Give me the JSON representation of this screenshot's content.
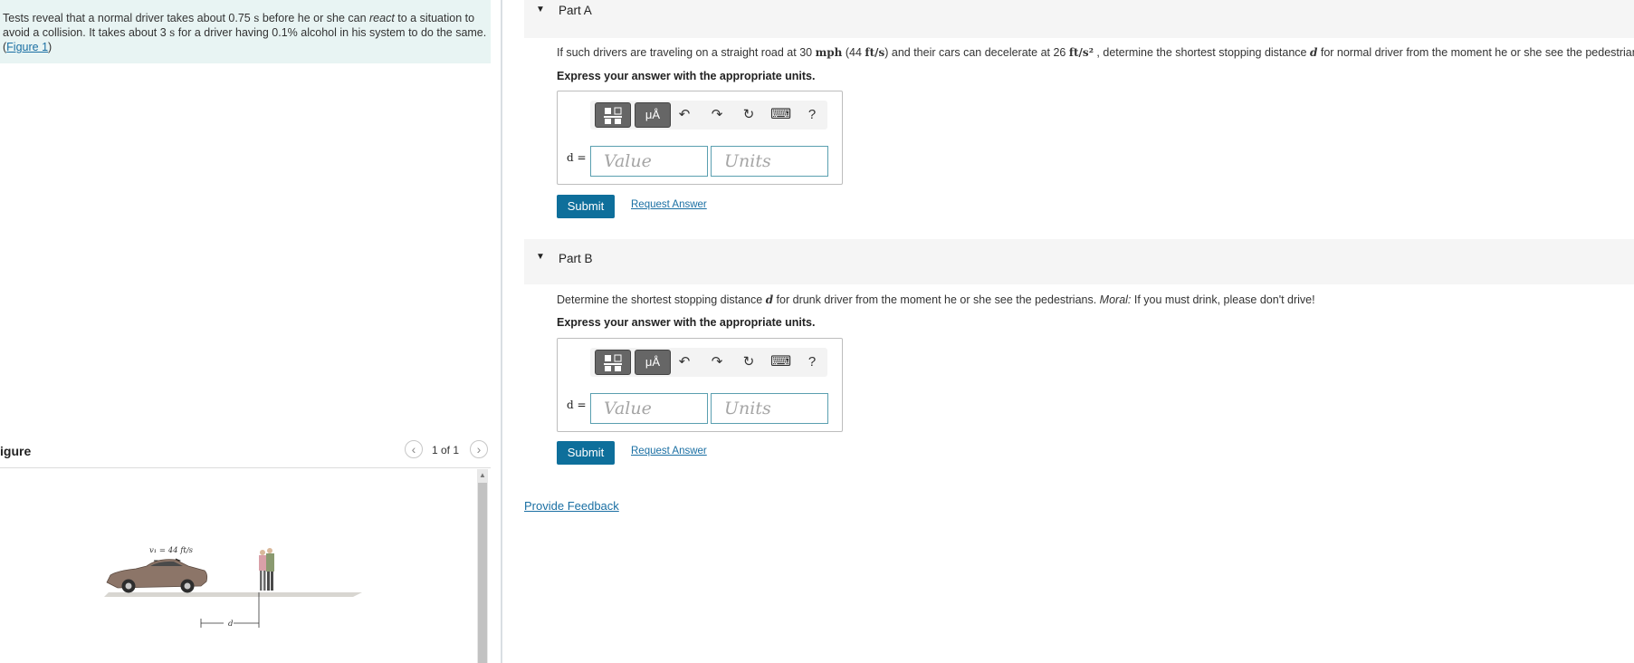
{
  "intro": {
    "line1_a": "Tests reveal that a normal driver takes about 0.75 ",
    "line1_s": "s",
    "line1_b": " before he or she can ",
    "line1_react": "react",
    "line1_c": " to a situation to",
    "line2_a": "avoid a collision. It takes about 3 ",
    "line2_s": "s",
    "line2_b": " for a driver having 0.1% alcohol in his system to do the same.",
    "figure_link_open": "(",
    "figure_link": "Figure 1",
    "figure_link_close": ")"
  },
  "figure_panel": {
    "title": "igure",
    "prev_icon": "‹",
    "next_icon": "›",
    "page_count": "1 of 1",
    "velocity_label": "v₁ = 44 ft/s",
    "distance_label": "d"
  },
  "partA": {
    "label": "Part A",
    "question_a": "If such drivers are traveling on a straight road at 30 ",
    "unit_mph": "mph",
    "question_b": " (44 ",
    "unit_fts": "ft/s",
    "question_c": ") and their cars can decelerate at 26 ",
    "unit_fts2": "ft/s²",
    "question_d": " , determine the shortest stopping distance ",
    "var_d": "d",
    "question_e": " for normal driver from the moment he or she see the pedestrians.",
    "instruction": "Express your answer with the appropriate units.",
    "d_label": "d =",
    "value_placeholder": "Value",
    "units_placeholder": "Units",
    "submit": "Submit",
    "request": "Request Answer"
  },
  "partB": {
    "label": "Part B",
    "question_a": "Determine the shortest stopping distance ",
    "var_d": "d",
    "question_b": " for drunk driver from the moment he or she see the pedestrians. ",
    "moral": "Moral:",
    "question_c": " If you must drink, please don't drive!",
    "instruction": "Express your answer with the appropriate units.",
    "d_label": "d =",
    "value_placeholder": "Value",
    "units_placeholder": "Units",
    "submit": "Submit",
    "request": "Request Answer"
  },
  "toolbar": {
    "templates_icon": "templates-icon",
    "units_label": "μÅ",
    "undo_icon": "↶",
    "redo_icon": "↷",
    "reset_icon": "↻",
    "keyboard_icon": "⌨",
    "help_label": "?"
  },
  "feedback": "Provide Feedback",
  "colors": {
    "accent": "#0e6f9b",
    "link": "#1a6fa3",
    "intro_bg": "#e8f4f3"
  }
}
